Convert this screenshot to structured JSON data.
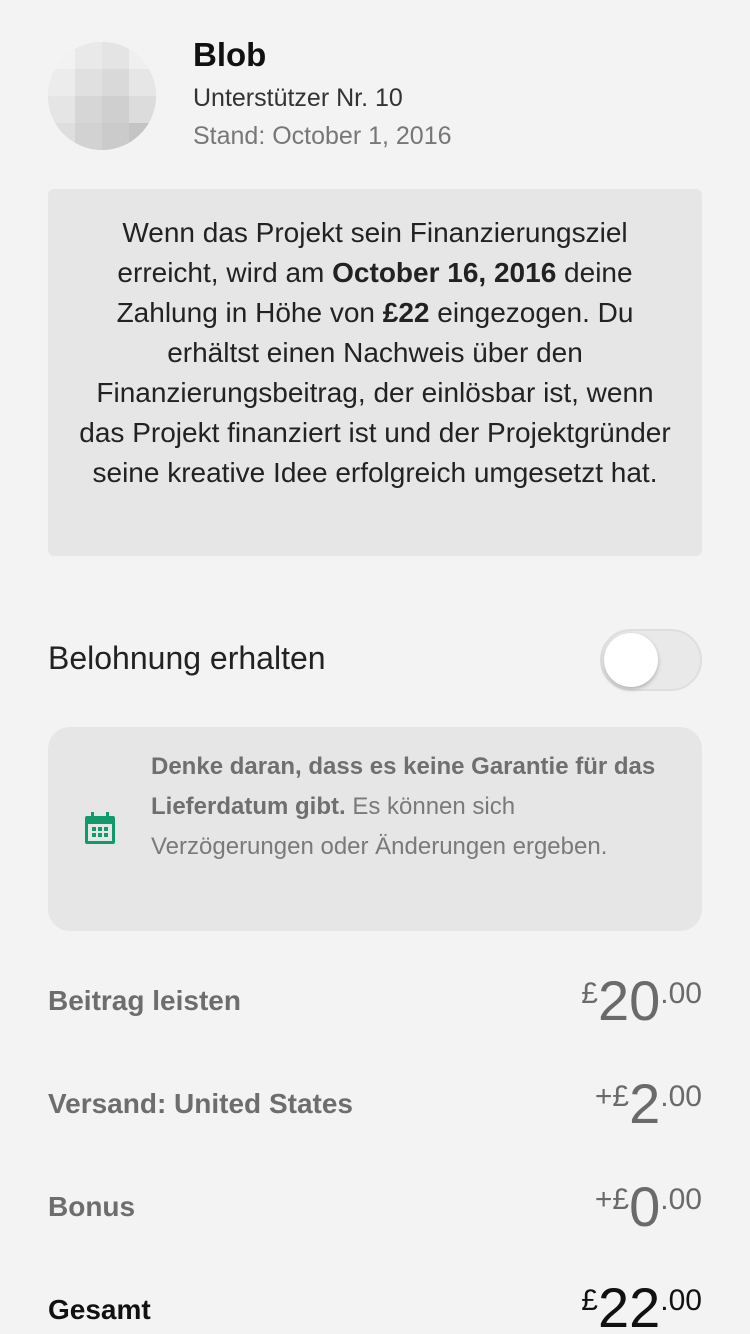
{
  "header": {
    "name": "Blob",
    "backer_number": "Unterstützer Nr. 10",
    "as_of": "Stand: October 1, 2016"
  },
  "info": {
    "part1": "Wenn das Projekt sein Finanzierungsziel erreicht, wird am ",
    "date": "October 16, 2016",
    "part2": " deine Zahlung in Höhe von ",
    "amount": "£22",
    "part3": " eingezogen. Du erhältst einen Nachweis über den Finanzierungsbeitrag, der einlösbar ist, wenn das Projekt finanziert ist und der Projektgründer seine kreative Idee erfolgreich umgesetzt hat."
  },
  "reward_toggle": {
    "label": "Belohnung erhalten",
    "on": false
  },
  "notice": {
    "icon": "calendar-icon",
    "bold": "Denke daran, dass es keine Garantie für das Lieferdatum gibt.",
    "text": " Es können sich Verzögerungen oder Änderungen ergeben."
  },
  "rows": {
    "pledge": {
      "label": "Beitrag leisten",
      "prefix": "£",
      "whole": "20",
      "cents": ".00"
    },
    "shipping": {
      "label": "Versand: United States",
      "prefix": "+£",
      "whole": "2",
      "cents": ".00"
    },
    "bonus": {
      "label": "Bonus",
      "prefix": "+£",
      "whole": "0",
      "cents": ".00"
    },
    "total": {
      "label": "Gesamt",
      "prefix": "£",
      "whole": "22",
      "cents": ".00"
    }
  },
  "colors": {
    "accent_green": "#0f9b6c",
    "background": "#f3f3f3",
    "box": "#e6e6e6"
  }
}
